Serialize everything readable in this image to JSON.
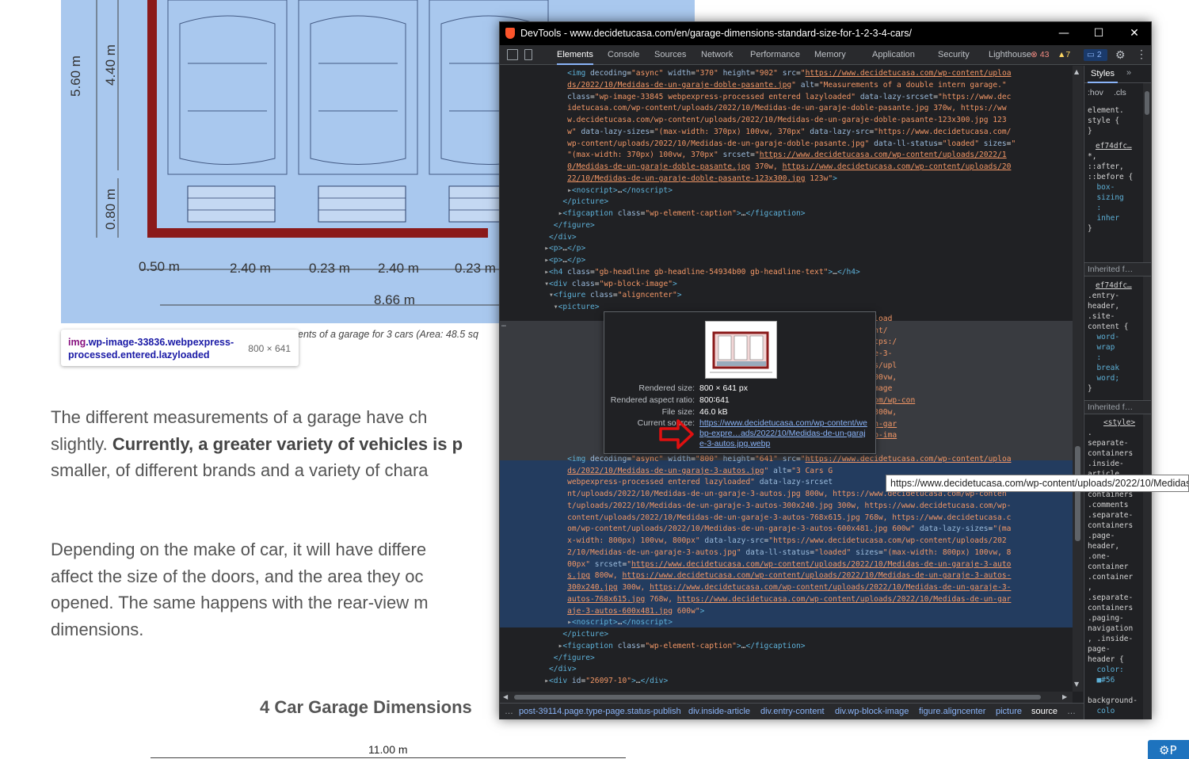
{
  "page": {
    "hero_dimensions": {
      "vertical_total": "5.60 m",
      "vertical_upper": "4.40 m",
      "vertical_lower": "0.80 m",
      "horizontal": [
        "0.50 m",
        "2.40 m",
        "0.23 m",
        "2.40 m",
        "0.23 m"
      ],
      "total_width": "8.66 m"
    },
    "element_tooltip": {
      "tag": "img",
      "classes": ".wp-image-33836.webpexpress-processed.entered.lazyloaded",
      "size": "800 × 641"
    },
    "figure_caption": "ents of a garage for 3 cars (Area: 48.5 sq",
    "paragraph1": {
      "line1": "The different measurements of a garage have ch",
      "line2_plain": "slightly. ",
      "line2_bold": "Currently, a greater variety of vehicles is p",
      "line3": "smaller, of different brands and a variety of chara"
    },
    "paragraph2": {
      "line1": "Depending on the make of car, it will have differe",
      "line2": "affect the size of the doors, and the area they oc",
      "line3": "opened. The same happens with the rear-view m",
      "line4": "dimensions."
    },
    "heading": "4 Car Garage Dimensions",
    "bottom_dimension": "11.00 m",
    "corner_button": "P"
  },
  "devtools": {
    "title": "DevTools - www.decidetucasa.com/en/garage-dimensions-standard-size-for-1-2-3-4-cars/",
    "window_controls": {
      "minimize": "—",
      "maximize": "☐",
      "close": "✕"
    },
    "tabs": [
      "Elements",
      "Console",
      "Sources",
      "Network",
      "Performance",
      "Memory",
      "Application",
      "Security",
      "Lighthouse"
    ],
    "active_tab": "Elements",
    "errors": "43",
    "warnings": "7",
    "messages": "2",
    "styles_pane": {
      "tab": "Styles",
      "more": "»",
      "hov": ":hov",
      "cls": ".cls",
      "lines_top": [
        "element.",
        "style {",
        "}"
      ],
      "rule1_source": "ef74dfc…",
      "rule1_lines": [
        "*,",
        "::after,",
        "::before {",
        "  box-",
        "  sizing",
        "  :",
        "  inher",
        "}"
      ],
      "inherited1": "Inherited f…",
      "rule2_source": "ef74dfc…",
      "rule2_lines": [
        ".entry-",
        "header,",
        ".site-",
        "content {",
        "  word-",
        "  wrap",
        "  :",
        "  break",
        "  word;",
        "}"
      ],
      "inherited2": "Inherited f…",
      "style_tag": "<style>",
      "rule3_lines": [
        ".",
        "separate-",
        "containers",
        ".inside-",
        "article,",
        ".separate-",
        "containers",
        ".comments",
        ".separate-",
        "containers",
        ".page-",
        "header,",
        ".one-",
        "container",
        ".container",
        ",",
        ".separate-",
        "containers",
        ".paging-",
        "navigation",
        ", .inside-",
        "page-",
        "header {",
        "  color:",
        "  ■#56",
        "",
        "background-",
        "  colo",
        "  :",
        "  ■#ff"
      ]
    },
    "code_lines": [
      {
        "indent": 13,
        "html": "<span class='t'>&lt;img</span> <span class='a'>decoding</span>=<span class='v'>\"async\"</span> <span class='a'>width</span>=<span class='v'>\"370\"</span> <span class='a'>height</span>=<span class='v'>\"902\"</span> <span class='a'>src</span>=<span class='v'>\"</span><span class='u'>https://www.decidetucasa.com/wp-content/uploa</span>"
      },
      {
        "indent": 13,
        "html": "<span class='u'>ds/2022/10/Medidas-de-un-garaje-doble-pasante.jpg</span><span class='v'>\"</span> <span class='a'>alt</span>=<span class='v'>\"Measurements of a double intern garage.\"</span>"
      },
      {
        "indent": 13,
        "html": "<span class='a'>class</span>=<span class='v'>\"wp-image-33845 webpexpress-processed entered lazyloaded\"</span> <span class='a'>data-lazy-srcset</span>=<span class='v'>\"https://www.dec</span>"
      },
      {
        "indent": 13,
        "html": "<span class='v'>idetucasa.com/wp-content/uploads/2022/10/Medidas-de-un-garaje-doble-pasante.jpg 370w, https://ww</span>"
      },
      {
        "indent": 13,
        "html": "<span class='v'>w.decidetucasa.com/wp-content/uploads/2022/10/Medidas-de-un-garaje-doble-pasante-123x300.jpg 123</span>"
      },
      {
        "indent": 13,
        "html": "<span class='v'>w\"</span> <span class='a'>data-lazy-sizes</span>=<span class='v'>\"(max-width: 370px) 100vw, 370px\"</span> <span class='a'>data-lazy-src</span>=<span class='v'>\"https://www.decidetucasa.com/</span>"
      },
      {
        "indent": 13,
        "html": "<span class='v'>wp-content/uploads/2022/10/Medidas-de-un-garaje-doble-pasante.jpg\"</span> <span class='a'>data-ll-status</span>=<span class='v'>\"loaded\"</span> <span class='a'>sizes</span>=<span class='v'>\"</span>"
      },
      {
        "indent": 13,
        "html": "<span class='v'>\"(max-width: 370px) 100vw, 370px\"</span> <span class='a'>srcset</span>=<span class='v'>\"</span><span class='u'>https://www.decidetucasa.com/wp-content/uploads/2022/1</span>"
      },
      {
        "indent": 13,
        "html": "<span class='u'>0/Medidas-de-un-garaje-doble-pasante.jpg</span><span class='v'> 370w, </span><span class='u'>https://www.decidetucasa.com/wp-content/uploads/20</span>"
      },
      {
        "indent": 13,
        "html": "<span class='u'>22/10/Medidas-de-un-garaje-doble-pasante-123x300.jpg</span><span class='v'> 123w\"</span><span class='t'>&gt;</span>"
      },
      {
        "indent": 13,
        "html": "<span class='p'>▸</span><span class='t'>&lt;noscript&gt;</span>…<span class='t'>&lt;/noscript&gt;</span>"
      },
      {
        "indent": 12,
        "html": "<span class='t'>&lt;/picture&gt;</span>"
      },
      {
        "indent": 11,
        "html": "<span class='p'>▸</span><span class='t'>&lt;figcaption</span> <span class='a'>class</span>=<span class='v'>\"wp-element-caption\"</span><span class='t'>&gt;</span>…<span class='t'>&lt;/figcaption&gt;</span>"
      },
      {
        "indent": 10,
        "html": "<span class='t'>&lt;/figure&gt;</span>"
      },
      {
        "indent": 9,
        "html": "<span class='t'>&lt;/div&gt;</span>"
      },
      {
        "indent": 8,
        "html": "<span class='p'>▸</span><span class='t'>&lt;p&gt;</span>…<span class='t'>&lt;/p&gt;</span>"
      },
      {
        "indent": 8,
        "html": "<span class='p'>▸</span><span class='t'>&lt;p&gt;</span>…<span class='t'>&lt;/p&gt;</span>"
      },
      {
        "indent": 8,
        "html": "<span class='p'>▸</span><span class='t'>&lt;h4</span> <span class='a'>class</span>=<span class='v'>\"gb-headline gb-headline-54934b00 gb-headline-text\"</span><span class='t'>&gt;</span>…<span class='t'>&lt;/h4&gt;</span>"
      },
      {
        "indent": 8,
        "html": "<span class='p'>▾</span><span class='t'>&lt;div</span> <span class='a'>class</span>=<span class='v'>\"wp-block-image\"</span><span class='t'>&gt;</span>"
      },
      {
        "indent": 9,
        "html": "<span class='p'>▾</span><span class='t'>&lt;figure</span> <span class='a'>class</span>=<span class='v'>\"aligncenter\"</span><span class='t'>&gt;</span>"
      },
      {
        "indent": 10,
        "html": "<span class='p'>▾</span><span class='t'>&lt;picture&gt;</span>"
      },
      {
        "indent": 44,
        "html": "<span class='v'>-content/webp-express/webp-images/upload</span>"
      },
      {
        "indent": 44,
        "html": "<span class='v'>ttps://www.decidetucasa.com/wp-content/</span>"
      },
      {
        "indent": 44,
        "html": "<span class='v'>je-3-autos-300x240.jpg.webp 300w, https:/</span>"
      },
      {
        "indent": 44,
        "html": "<span class='v'>/uploads/2022/10/Medidas-de-un-garaje-3-</span>"
      },
      {
        "indent": 44,
        "html": "<span class='v'>m/wp-content/webp-express/webp-images/upl</span>"
      },
      {
        "indent": 44,
        "html": "<span class='v'>op 600w\"</span> <span class='a'>sizes</span>=<span class='v'>\"(max-width: 800px) 100vw,</span>"
      },
      {
        "indent": 44,
        "html": "<span class='v'>a.com/wp-content/webp-express/webp-image</span>"
      },
      {
        "indent": 44,
        "html": "<span class='v'>ebp 800w, </span><span class='u'>https://www.decidetucasa.com/wp-con</span>"
      },
      {
        "indent": 44,
        "html": "<span class='u'>-un-garaje-3-autos-300x240.jpg.webp</span><span class='v'> 300w,</span>"
      },
      {
        "indent": 44,
        "html": "<span class='u'>-images/uploads/2022/10/Medidas-de-un-gar</span>"
      },
      {
        "indent": 44,
        "html": "<span class='u'>casa.com/wp-content/webp-express/webp-ima</span>"
      },
      {
        "indent": 44,
        "html": "<span class='u'>.jpg.webp</span><span class='v'> 600w\"</span><span class='t'>&gt;</span> <span class='p'>== $0</span>"
      },
      {
        "indent": 13,
        "html": "<span class='t'>&lt;img</span> <span class='a'>decoding</span>=<span class='v'>\"async\"</span> <span class='a'>width</span>=<span class='v'>\"800\"</span> <span class='a'>height</span>=<span class='v'>\"641\"</span> <span class='a'>src</span>=<span class='v'>\"</span><span class='u'>https://www.decidetucasa.com/wp-content/uploa</span>"
      },
      {
        "indent": 13,
        "html": "<span class='u'>ds/2022/10/Medidas-de-un-garaje-3-autos.jpg</span><span class='v'>\"</span> <span class='a'>alt</span>=<span class='v'>\"3 Cars G</span>"
      },
      {
        "indent": 13,
        "html": "<span class='v'>webpexpress-processed entered lazyloaded\"</span> <span class='a'>data-lazy-srcset</span>"
      },
      {
        "indent": 13,
        "html": "<span class='v'>nt/uploads/2022/10/Medidas-de-un-garaje-3-autos.jpg 800w, https://www.decidetucasa.com/wp-conten</span>"
      },
      {
        "indent": 13,
        "html": "<span class='v'>t/uploads/2022/10/Medidas-de-un-garaje-3-autos-300x240.jpg 300w, https://www.decidetucasa.com/wp-</span>"
      },
      {
        "indent": 13,
        "html": "<span class='v'>content/uploads/2022/10/Medidas-de-un-garaje-3-autos-768x615.jpg 768w, https://www.decidetucasa.c</span>"
      },
      {
        "indent": 13,
        "html": "<span class='v'>om/wp-content/uploads/2022/10/Medidas-de-un-garaje-3-autos-600x481.jpg 600w\"</span> <span class='a'>data-lazy-sizes</span>=<span class='v'>\"(ma</span>"
      },
      {
        "indent": 13,
        "html": "<span class='v'>x-width: 800px) 100vw, 800px\"</span> <span class='a'>data-lazy-src</span>=<span class='v'>\"https://www.decidetucasa.com/wp-content/uploads/202</span>"
      },
      {
        "indent": 13,
        "html": "<span class='v'>2/10/Medidas-de-un-garaje-3-autos.jpg\"</span> <span class='a'>data-ll-status</span>=<span class='v'>\"loaded\"</span> <span class='a'>sizes</span>=<span class='v'>\"(max-width: 800px) 100vw, 8</span>"
      },
      {
        "indent": 13,
        "html": "<span class='v'>00px\"</span> <span class='a'>srcset</span>=<span class='v'>\"</span><span class='u'>https://www.decidetucasa.com/wp-content/uploads/2022/10/Medidas-de-un-garaje-3-auto</span>"
      },
      {
        "indent": 13,
        "html": "<span class='u'>s.jpg</span><span class='v'> 800w, </span><span class='u'>https://www.decidetucasa.com/wp-content/uploads/2022/10/Medidas-de-un-garaje-3-autos-</span>"
      },
      {
        "indent": 13,
        "html": "<span class='u'>300x240.jpg</span><span class='v'> 300w, </span><span class='u'>https://www.decidetucasa.com/wp-content/uploads/2022/10/Medidas-de-un-garaje-3-</span>"
      },
      {
        "indent": 13,
        "html": "<span class='u'>autos-768x615.jpg</span><span class='v'> 768w, </span><span class='u'>https://www.decidetucasa.com/wp-content/uploads/2022/10/Medidas-de-un-gar</span>"
      },
      {
        "indent": 13,
        "html": "<span class='u'>aje-3-autos-600x481.jpg</span><span class='v'> 600w\"</span><span class='t'>&gt;</span>"
      },
      {
        "indent": 13,
        "html": "<span class='p'>▸</span><span class='t'>&lt;noscript&gt;</span>…<span class='t'>&lt;/noscript&gt;</span>"
      },
      {
        "indent": 12,
        "html": "<span class='t'>&lt;/picture&gt;</span>"
      },
      {
        "indent": 11,
        "html": "<span class='p'>▸</span><span class='t'>&lt;figcaption</span> <span class='a'>class</span>=<span class='v'>\"wp-element-caption\"</span><span class='t'>&gt;</span>…<span class='t'>&lt;/figcaption&gt;</span>"
      },
      {
        "indent": 10,
        "html": "<span class='t'>&lt;/figure&gt;</span>"
      },
      {
        "indent": 9,
        "html": "<span class='t'>&lt;/div&gt;</span>"
      },
      {
        "indent": 8,
        "html": "<span class='p'>▸</span><span class='t'>&lt;div</span> <span class='a'>id</span>=<span class='v'>\"26097-10\"</span><span class='t'>&gt;</span>…<span class='t'>&lt;/div&gt;</span>"
      }
    ],
    "breadcrumbs": [
      "…",
      "post-39114.page.type-page.status-publish",
      "div.inside-article",
      "div.entry-content",
      "div.wp-block-image",
      "figure.aligncenter",
      "picture",
      "source",
      "…"
    ],
    "gutter_dots": "…",
    "preview": {
      "rendered_size_label": "Rendered size:",
      "rendered_size": "800 × 641 px",
      "aspect_label": "Rendered aspect ratio:",
      "aspect": "800∶641",
      "file_size_label": "File size:",
      "file_size": "46.0 kB",
      "current_source_label": "Current source:",
      "current_source": "https://www.decidetucasa.com/wp-content/webp-expre…ads/2022/10/Medidas-de-un-garaje-3-autos.jpg.webp"
    },
    "url_tooltip": "https://www.decidetucasa.com/wp-content/uploads/2022/10/Medidas-"
  },
  "colors": {
    "devtools_bg": "#202124",
    "titlebar": "#000000",
    "accent": "#8ab4f8",
    "tag": "#5db0d7",
    "attr_value": "#f29766",
    "highlight_row": "#233c5f",
    "hero_blue": "#a9c8ee"
  }
}
